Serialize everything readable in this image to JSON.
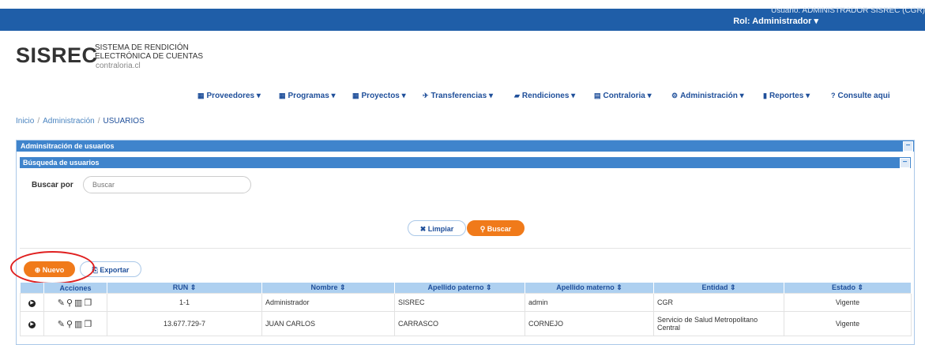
{
  "header": {
    "user_text": "Usuario: ADMINISTRADOR SISREC (CGR)",
    "role_text": "Rol: Administrador",
    "role_caret": "▾"
  },
  "logo": {
    "main": "SISREC",
    "line1": "SISTEMA DE RENDICIÓN",
    "line2": "ELECTRÓNICA DE CUENTAS",
    "line3": "contraloria.cl"
  },
  "nav": {
    "items": [
      {
        "label": "Proveedores",
        "icon": "calendar-icon",
        "glyph": "▦"
      },
      {
        "label": "Programas",
        "icon": "calendar-icon",
        "glyph": "▦"
      },
      {
        "label": "Proyectos",
        "icon": "calendar-icon",
        "glyph": "▦"
      },
      {
        "label": "Transferencias",
        "icon": "plane-icon",
        "glyph": "✈"
      },
      {
        "label": "Rendiciones",
        "icon": "document-icon",
        "glyph": "▰"
      },
      {
        "label": "Contraloria",
        "icon": "file-icon",
        "glyph": "▤"
      },
      {
        "label": "Administración",
        "icon": "cogs-icon",
        "glyph": "⚙"
      },
      {
        "label": "Reportes",
        "icon": "bar-chart-icon",
        "glyph": "▮"
      },
      {
        "label": "Consulte aqui",
        "icon": "question-icon",
        "glyph": "?"
      }
    ],
    "caret": "▾"
  },
  "breadcrumb": {
    "home": "Inicio",
    "section": "Administración",
    "current": "USUARIOS",
    "separator": "/"
  },
  "panel": {
    "title": "Adminsitración de usuarios",
    "subtitle": "Búsqueda de usuarios",
    "collapse_glyph": "−"
  },
  "search": {
    "label": "Buscar por",
    "placeholder": "Buscar",
    "value": ""
  },
  "buttons": {
    "limpiar": "Limpiar",
    "buscar": "Buscar",
    "nuevo": "Nuevo",
    "exportar": "Exportar"
  },
  "table": {
    "headers": [
      "Acciones",
      "RUN ⇕",
      "Nombre ⇕",
      "Apellido paterno ⇕",
      "Apellido materno ⇕",
      "Entidad ⇕",
      "Estado ⇕"
    ],
    "rows": [
      {
        "run": "1-1",
        "nombre": "Administrador",
        "ap_paterno": "SISREC",
        "ap_materno": "admin",
        "entidad": "CGR",
        "estado": "Vigente"
      },
      {
        "run": "13.677.729-7",
        "nombre": "JUAN CARLOS",
        "ap_paterno": "CARRASCO",
        "ap_materno": "CORNEJO",
        "entidad": "Servicio de Salud Metropolitano Central",
        "estado": "Vigente"
      }
    ]
  },
  "colors": {
    "topbar": "#1f5ea8",
    "panel_header": "#3f84cc",
    "accent": "#f07a1a",
    "table_header": "#aed0f0",
    "highlight_circle": "#e02020"
  }
}
